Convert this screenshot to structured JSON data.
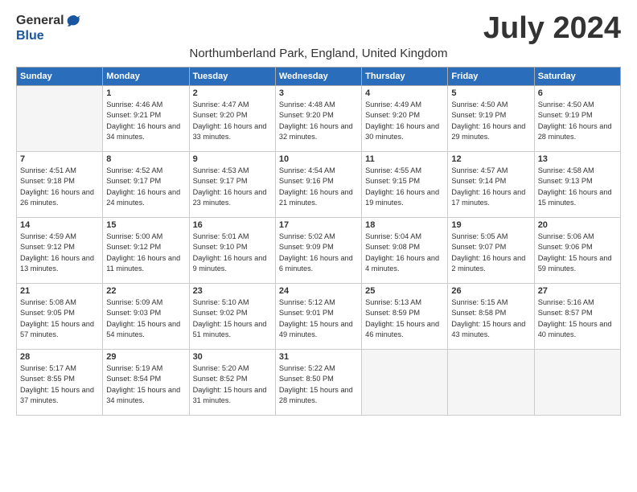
{
  "logo": {
    "general": "General",
    "blue": "Blue"
  },
  "title": "July 2024",
  "location": "Northumberland Park, England, United Kingdom",
  "days_of_week": [
    "Sunday",
    "Monday",
    "Tuesday",
    "Wednesday",
    "Thursday",
    "Friday",
    "Saturday"
  ],
  "weeks": [
    [
      {
        "day": "",
        "sunrise": "",
        "sunset": "",
        "daylight": ""
      },
      {
        "day": "1",
        "sunrise": "Sunrise: 4:46 AM",
        "sunset": "Sunset: 9:21 PM",
        "daylight": "Daylight: 16 hours and 34 minutes."
      },
      {
        "day": "2",
        "sunrise": "Sunrise: 4:47 AM",
        "sunset": "Sunset: 9:20 PM",
        "daylight": "Daylight: 16 hours and 33 minutes."
      },
      {
        "day": "3",
        "sunrise": "Sunrise: 4:48 AM",
        "sunset": "Sunset: 9:20 PM",
        "daylight": "Daylight: 16 hours and 32 minutes."
      },
      {
        "day": "4",
        "sunrise": "Sunrise: 4:49 AM",
        "sunset": "Sunset: 9:20 PM",
        "daylight": "Daylight: 16 hours and 30 minutes."
      },
      {
        "day": "5",
        "sunrise": "Sunrise: 4:50 AM",
        "sunset": "Sunset: 9:19 PM",
        "daylight": "Daylight: 16 hours and 29 minutes."
      },
      {
        "day": "6",
        "sunrise": "Sunrise: 4:50 AM",
        "sunset": "Sunset: 9:19 PM",
        "daylight": "Daylight: 16 hours and 28 minutes."
      }
    ],
    [
      {
        "day": "7",
        "sunrise": "Sunrise: 4:51 AM",
        "sunset": "Sunset: 9:18 PM",
        "daylight": "Daylight: 16 hours and 26 minutes."
      },
      {
        "day": "8",
        "sunrise": "Sunrise: 4:52 AM",
        "sunset": "Sunset: 9:17 PM",
        "daylight": "Daylight: 16 hours and 24 minutes."
      },
      {
        "day": "9",
        "sunrise": "Sunrise: 4:53 AM",
        "sunset": "Sunset: 9:17 PM",
        "daylight": "Daylight: 16 hours and 23 minutes."
      },
      {
        "day": "10",
        "sunrise": "Sunrise: 4:54 AM",
        "sunset": "Sunset: 9:16 PM",
        "daylight": "Daylight: 16 hours and 21 minutes."
      },
      {
        "day": "11",
        "sunrise": "Sunrise: 4:55 AM",
        "sunset": "Sunset: 9:15 PM",
        "daylight": "Daylight: 16 hours and 19 minutes."
      },
      {
        "day": "12",
        "sunrise": "Sunrise: 4:57 AM",
        "sunset": "Sunset: 9:14 PM",
        "daylight": "Daylight: 16 hours and 17 minutes."
      },
      {
        "day": "13",
        "sunrise": "Sunrise: 4:58 AM",
        "sunset": "Sunset: 9:13 PM",
        "daylight": "Daylight: 16 hours and 15 minutes."
      }
    ],
    [
      {
        "day": "14",
        "sunrise": "Sunrise: 4:59 AM",
        "sunset": "Sunset: 9:12 PM",
        "daylight": "Daylight: 16 hours and 13 minutes."
      },
      {
        "day": "15",
        "sunrise": "Sunrise: 5:00 AM",
        "sunset": "Sunset: 9:12 PM",
        "daylight": "Daylight: 16 hours and 11 minutes."
      },
      {
        "day": "16",
        "sunrise": "Sunrise: 5:01 AM",
        "sunset": "Sunset: 9:10 PM",
        "daylight": "Daylight: 16 hours and 9 minutes."
      },
      {
        "day": "17",
        "sunrise": "Sunrise: 5:02 AM",
        "sunset": "Sunset: 9:09 PM",
        "daylight": "Daylight: 16 hours and 6 minutes."
      },
      {
        "day": "18",
        "sunrise": "Sunrise: 5:04 AM",
        "sunset": "Sunset: 9:08 PM",
        "daylight": "Daylight: 16 hours and 4 minutes."
      },
      {
        "day": "19",
        "sunrise": "Sunrise: 5:05 AM",
        "sunset": "Sunset: 9:07 PM",
        "daylight": "Daylight: 16 hours and 2 minutes."
      },
      {
        "day": "20",
        "sunrise": "Sunrise: 5:06 AM",
        "sunset": "Sunset: 9:06 PM",
        "daylight": "Daylight: 15 hours and 59 minutes."
      }
    ],
    [
      {
        "day": "21",
        "sunrise": "Sunrise: 5:08 AM",
        "sunset": "Sunset: 9:05 PM",
        "daylight": "Daylight: 15 hours and 57 minutes."
      },
      {
        "day": "22",
        "sunrise": "Sunrise: 5:09 AM",
        "sunset": "Sunset: 9:03 PM",
        "daylight": "Daylight: 15 hours and 54 minutes."
      },
      {
        "day": "23",
        "sunrise": "Sunrise: 5:10 AM",
        "sunset": "Sunset: 9:02 PM",
        "daylight": "Daylight: 15 hours and 51 minutes."
      },
      {
        "day": "24",
        "sunrise": "Sunrise: 5:12 AM",
        "sunset": "Sunset: 9:01 PM",
        "daylight": "Daylight: 15 hours and 49 minutes."
      },
      {
        "day": "25",
        "sunrise": "Sunrise: 5:13 AM",
        "sunset": "Sunset: 8:59 PM",
        "daylight": "Daylight: 15 hours and 46 minutes."
      },
      {
        "day": "26",
        "sunrise": "Sunrise: 5:15 AM",
        "sunset": "Sunset: 8:58 PM",
        "daylight": "Daylight: 15 hours and 43 minutes."
      },
      {
        "day": "27",
        "sunrise": "Sunrise: 5:16 AM",
        "sunset": "Sunset: 8:57 PM",
        "daylight": "Daylight: 15 hours and 40 minutes."
      }
    ],
    [
      {
        "day": "28",
        "sunrise": "Sunrise: 5:17 AM",
        "sunset": "Sunset: 8:55 PM",
        "daylight": "Daylight: 15 hours and 37 minutes."
      },
      {
        "day": "29",
        "sunrise": "Sunrise: 5:19 AM",
        "sunset": "Sunset: 8:54 PM",
        "daylight": "Daylight: 15 hours and 34 minutes."
      },
      {
        "day": "30",
        "sunrise": "Sunrise: 5:20 AM",
        "sunset": "Sunset: 8:52 PM",
        "daylight": "Daylight: 15 hours and 31 minutes."
      },
      {
        "day": "31",
        "sunrise": "Sunrise: 5:22 AM",
        "sunset": "Sunset: 8:50 PM",
        "daylight": "Daylight: 15 hours and 28 minutes."
      },
      {
        "day": "",
        "sunrise": "",
        "sunset": "",
        "daylight": ""
      },
      {
        "day": "",
        "sunrise": "",
        "sunset": "",
        "daylight": ""
      },
      {
        "day": "",
        "sunrise": "",
        "sunset": "",
        "daylight": ""
      }
    ]
  ]
}
